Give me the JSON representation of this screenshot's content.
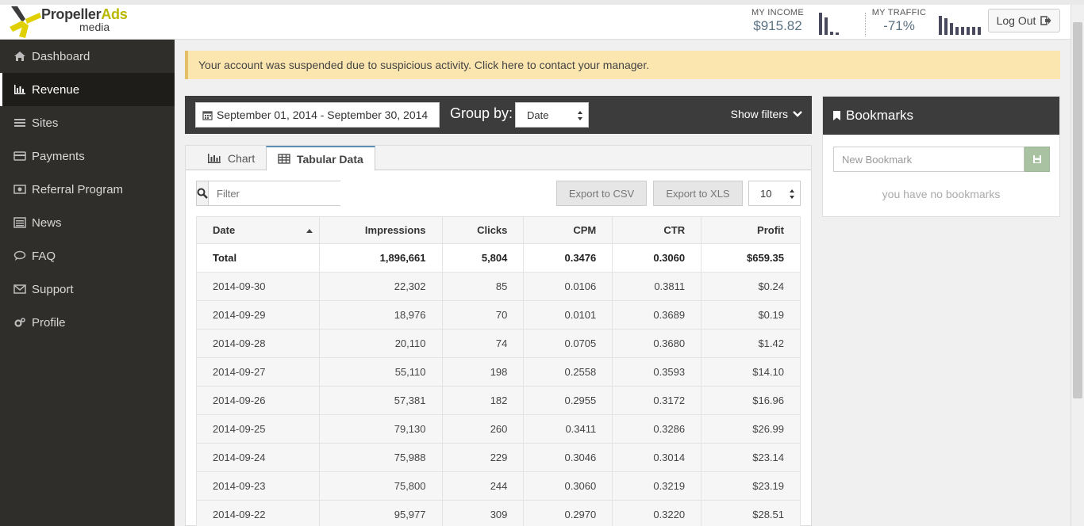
{
  "header": {
    "logo_text_main": "Propeller",
    "logo_text_accent": "Ads",
    "logo_text_sub": "media",
    "income_label": "MY INCOME",
    "income_value": "$915.82",
    "traffic_label": "MY TRAFFIC",
    "traffic_value": "-71%",
    "logout_label": "Log Out",
    "income_bar_levels": [
      1.0,
      0.8,
      0.15,
      0.1
    ],
    "traffic_bar_levels": [
      0.85,
      0.75,
      0.55,
      0.35,
      0.35,
      0.35,
      0.35,
      0.35
    ]
  },
  "sidebar": {
    "items": [
      {
        "label": "Dashboard",
        "icon": "home-icon"
      },
      {
        "label": "Revenue",
        "icon": "bar-chart-icon",
        "active": true
      },
      {
        "label": "Sites",
        "icon": "list-icon"
      },
      {
        "label": "Payments",
        "icon": "credit-card-icon"
      },
      {
        "label": "Referral Program",
        "icon": "money-icon"
      },
      {
        "label": "News",
        "icon": "newspaper-icon"
      },
      {
        "label": "FAQ",
        "icon": "comment-icon"
      },
      {
        "label": "Support",
        "icon": "envelope-icon"
      },
      {
        "label": "Profile",
        "icon": "cogs-icon"
      }
    ]
  },
  "alert": {
    "text": "Your account was suspended due to suspicious activity. Click here to contact your manager."
  },
  "toolbar": {
    "date_range": "September 01, 2014 - September 30, 2014",
    "group_by_label": "Group by:",
    "group_by_value": "Date",
    "show_filters": "Show filters"
  },
  "tabs": {
    "chart": "Chart",
    "tabular": "Tabular Data"
  },
  "table_controls": {
    "filter_placeholder": "Filter",
    "export_csv": "Export to CSV",
    "export_xls": "Export to XLS",
    "per_page": "10"
  },
  "table": {
    "columns": [
      "Date",
      "Impressions",
      "Clicks",
      "CPM",
      "CTR",
      "Profit"
    ],
    "total": [
      "Total",
      "1,896,661",
      "5,804",
      "0.3476",
      "0.3060",
      "$659.35"
    ],
    "rows": [
      [
        "2014-09-30",
        "22,302",
        "85",
        "0.0106",
        "0.3811",
        "$0.24"
      ],
      [
        "2014-09-29",
        "18,976",
        "70",
        "0.0101",
        "0.3689",
        "$0.19"
      ],
      [
        "2014-09-28",
        "20,110",
        "74",
        "0.0705",
        "0.3680",
        "$1.42"
      ],
      [
        "2014-09-27",
        "55,110",
        "198",
        "0.2558",
        "0.3593",
        "$14.10"
      ],
      [
        "2014-09-26",
        "57,381",
        "182",
        "0.2955",
        "0.3172",
        "$16.96"
      ],
      [
        "2014-09-25",
        "79,130",
        "260",
        "0.3411",
        "0.3286",
        "$26.99"
      ],
      [
        "2014-09-24",
        "75,988",
        "229",
        "0.3046",
        "0.3014",
        "$23.14"
      ],
      [
        "2014-09-23",
        "75,800",
        "244",
        "0.3060",
        "0.3219",
        "$23.19"
      ],
      [
        "2014-09-22",
        "95,977",
        "309",
        "0.2970",
        "0.3220",
        "$28.51"
      ]
    ]
  },
  "bookmarks": {
    "title": "Bookmarks",
    "input_placeholder": "New Bookmark",
    "empty_text": "you have no bookmarks"
  }
}
